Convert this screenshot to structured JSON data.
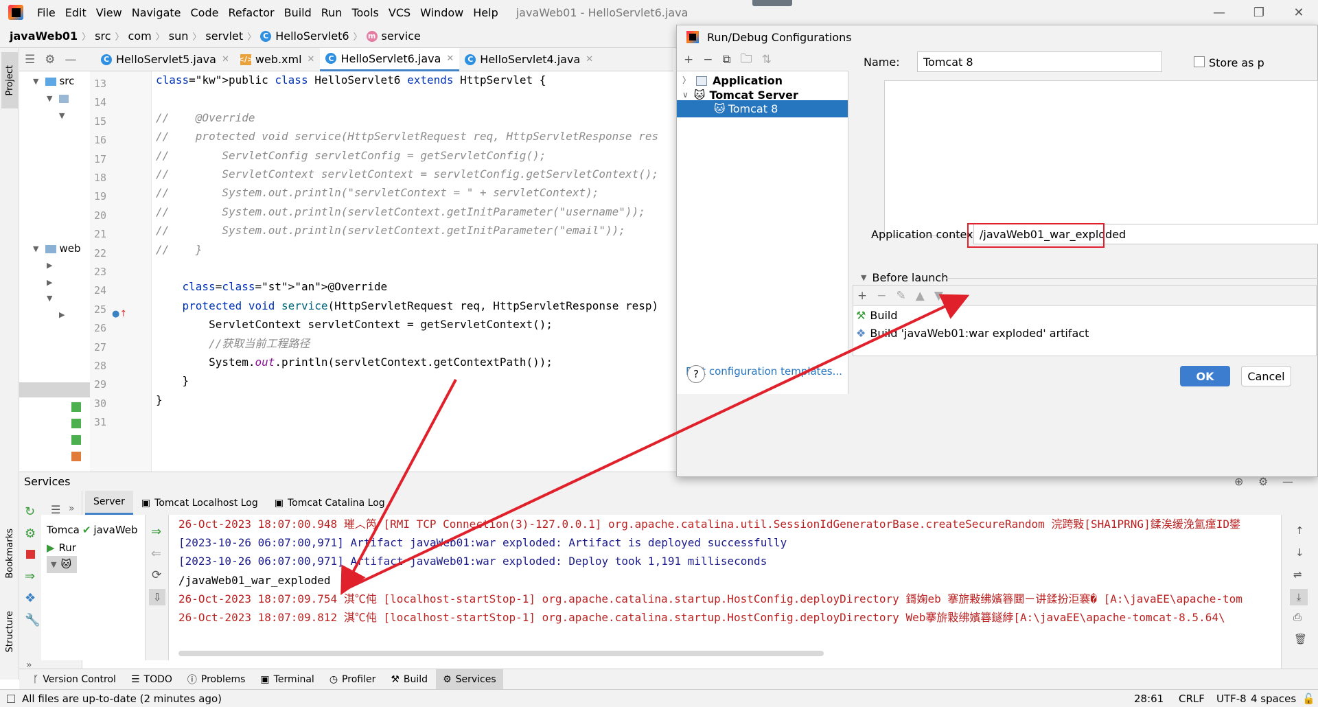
{
  "menubar": {
    "items": [
      "File",
      "Edit",
      "View",
      "Navigate",
      "Code",
      "Refactor",
      "Build",
      "Run",
      "Tools",
      "VCS",
      "Window",
      "Help"
    ],
    "title": "javaWeb01 - HelloServlet6.java"
  },
  "navbar": {
    "crumbs": [
      "javaWeb01",
      "src",
      "com",
      "sun",
      "servlet",
      "HelloServlet6",
      "service"
    ]
  },
  "sidebar": {
    "project_label": "Project",
    "bookmarks_label": "Bookmarks",
    "structure_label": "Structure"
  },
  "tree": {
    "src": "src",
    "web": "web"
  },
  "tabs": [
    {
      "label": "HelloServlet5.java",
      "icon": "class-icon"
    },
    {
      "label": "web.xml",
      "icon": "xml-icon"
    },
    {
      "label": "HelloServlet6.java",
      "icon": "class-icon"
    },
    {
      "label": "HelloServlet4.java",
      "icon": "class-icon"
    }
  ],
  "editor": {
    "line_numbers": [
      "13",
      "14",
      "15",
      "16",
      "17",
      "18",
      "19",
      "20",
      "21",
      "22",
      "23",
      "24",
      "25",
      "26",
      "27",
      "28",
      "29",
      "30",
      "31"
    ],
    "lines": [
      "public class HelloServlet6 extends HttpServlet {",
      "",
      "//    @Override",
      "//    protected void service(HttpServletRequest req, HttpServletResponse res",
      "//        ServletConfig servletConfig = getServletConfig();",
      "//        ServletContext servletContext = servletConfig.getServletContext();",
      "//        System.out.println(\"servletContext = \" + servletContext);",
      "//        System.out.println(servletContext.getInitParameter(\"username\"));",
      "//        System.out.println(servletContext.getInitParameter(\"email\"));",
      "//    }",
      "",
      "    @Override",
      "    protected void service(HttpServletRequest req, HttpServletResponse resp)",
      "        ServletContext servletContext = getServletContext();",
      "        //获取当前工程路径",
      "        System.out.println(servletContext.getContextPath());",
      "    }",
      "}",
      ""
    ]
  },
  "services": {
    "title": "Services",
    "tabs": [
      "Server",
      "Tomcat Localhost Log",
      "Tomcat Catalina Log"
    ],
    "tree": {
      "tomcat": "Tomca",
      "deployment": "javaWeb",
      "run": "Rur"
    },
    "log": [
      "26-Oct-2023 18:07:00.948 璀︿笍 [RMI TCP Connection(3)-127.0.0.1] org.apache.catalina.util.SessionIdGeneratorBase.createSecureRandom 浣跨敤[SHA1PRNG]鍒涘缓浼氳瘽ID鐢",
      "[2023-10-26 06:07:00,971] Artifact javaWeb01:war exploded: Artifact is deployed successfully",
      "[2023-10-26 06:07:00,971] Artifact javaWeb01:war exploded: Deploy took 1,191 milliseconds",
      "/javaWeb01_war_exploded",
      "26-Oct-2023 18:07:09.754 淇℃伅 [localhost-startStop-1] org.apache.catalina.startup.HostConfig.deployDirectory 鎶婅eb 搴旂敤绋嬪簭閮ㄧ讲鍒扮洰褰� [A:\\javaEE\\apache-tom",
      "26-Oct-2023 18:07:09.812 淇℃伅 [localhost-startStop-1] org.apache.catalina.startup.HostConfig.deployDirectory Web搴旂敤绋嬪簭鐩綍[A:\\javaEE\\apache-tomcat-8.5.64\\"
    ]
  },
  "bottombar": [
    "Version Control",
    "TODO",
    "Problems",
    "Terminal",
    "Profiler",
    "Build",
    "Services"
  ],
  "status": {
    "message": "All files are up-to-date (2 minutes ago)",
    "position": "28:61",
    "line_sep": "CRLF",
    "encoding": "UTF-8",
    "indent": "4 spaces"
  },
  "dialog": {
    "title": "Run/Debug Configurations",
    "tree": {
      "application": "Application",
      "tomcat_server": "Tomcat Server",
      "tomcat8": "Tomcat 8"
    },
    "edit_templates": "Edit configuration templates...",
    "name_label": "Name:",
    "name_value": "Tomcat 8",
    "store_label": "Store as p",
    "context_label": "Application context:",
    "context_value": "/javaWeb01_war_exploded",
    "before_launch": "Before launch",
    "before_items": [
      "Build",
      "Build 'javaWeb01:war exploded' artifact"
    ],
    "ok": "OK",
    "cancel": "Cancel",
    "help": "?"
  },
  "colors": {
    "accent": "#4083c9",
    "ok_button": "#3d7dd0",
    "selection": "#2675bf",
    "annotation_red": "#e0202a"
  }
}
